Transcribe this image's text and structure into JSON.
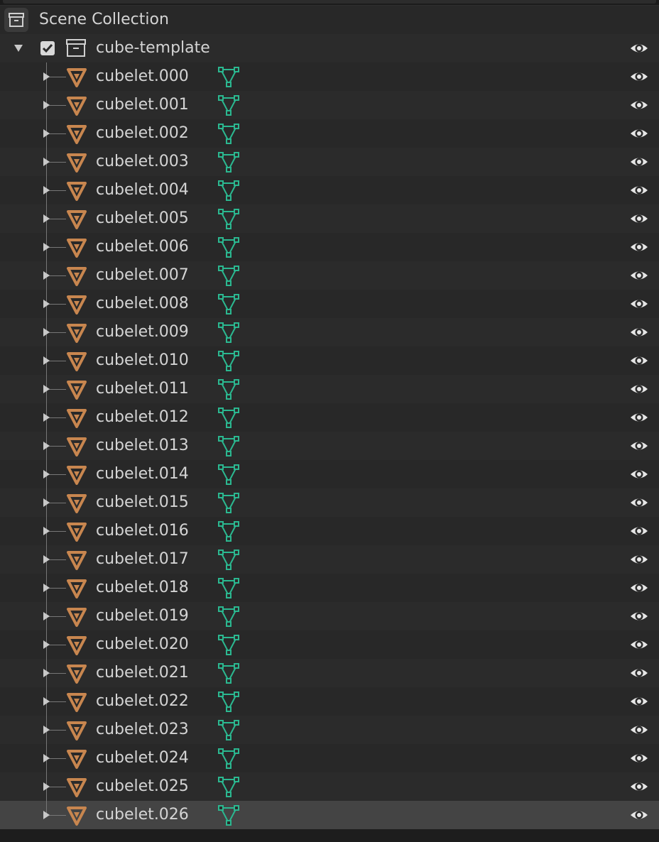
{
  "scene": {
    "label": "Scene Collection",
    "icon": "scene-collection-icon"
  },
  "collection": {
    "label": "cube-template",
    "checked": true,
    "icon": "collection-icon",
    "visible": true
  },
  "objects": [
    {
      "name": "cubelet.000"
    },
    {
      "name": "cubelet.001"
    },
    {
      "name": "cubelet.002"
    },
    {
      "name": "cubelet.003"
    },
    {
      "name": "cubelet.004"
    },
    {
      "name": "cubelet.005"
    },
    {
      "name": "cubelet.006"
    },
    {
      "name": "cubelet.007"
    },
    {
      "name": "cubelet.008"
    },
    {
      "name": "cubelet.009"
    },
    {
      "name": "cubelet.010"
    },
    {
      "name": "cubelet.011"
    },
    {
      "name": "cubelet.012"
    },
    {
      "name": "cubelet.013"
    },
    {
      "name": "cubelet.014"
    },
    {
      "name": "cubelet.015"
    },
    {
      "name": "cubelet.016"
    },
    {
      "name": "cubelet.017"
    },
    {
      "name": "cubelet.018"
    },
    {
      "name": "cubelet.019"
    },
    {
      "name": "cubelet.020"
    },
    {
      "name": "cubelet.021"
    },
    {
      "name": "cubelet.022"
    },
    {
      "name": "cubelet.023"
    },
    {
      "name": "cubelet.024"
    },
    {
      "name": "cubelet.025"
    },
    {
      "name": "cubelet.026",
      "selected": true
    }
  ],
  "icons": {
    "object": "mesh-object-icon",
    "mesh_data": "mesh-data-icon",
    "visibility": "eye-icon",
    "expand": "expand-arrow-icon"
  },
  "colors": {
    "object_icon": "#c8864f",
    "mesh_data_icon": "#2bb890",
    "selected_row": "#444444"
  }
}
